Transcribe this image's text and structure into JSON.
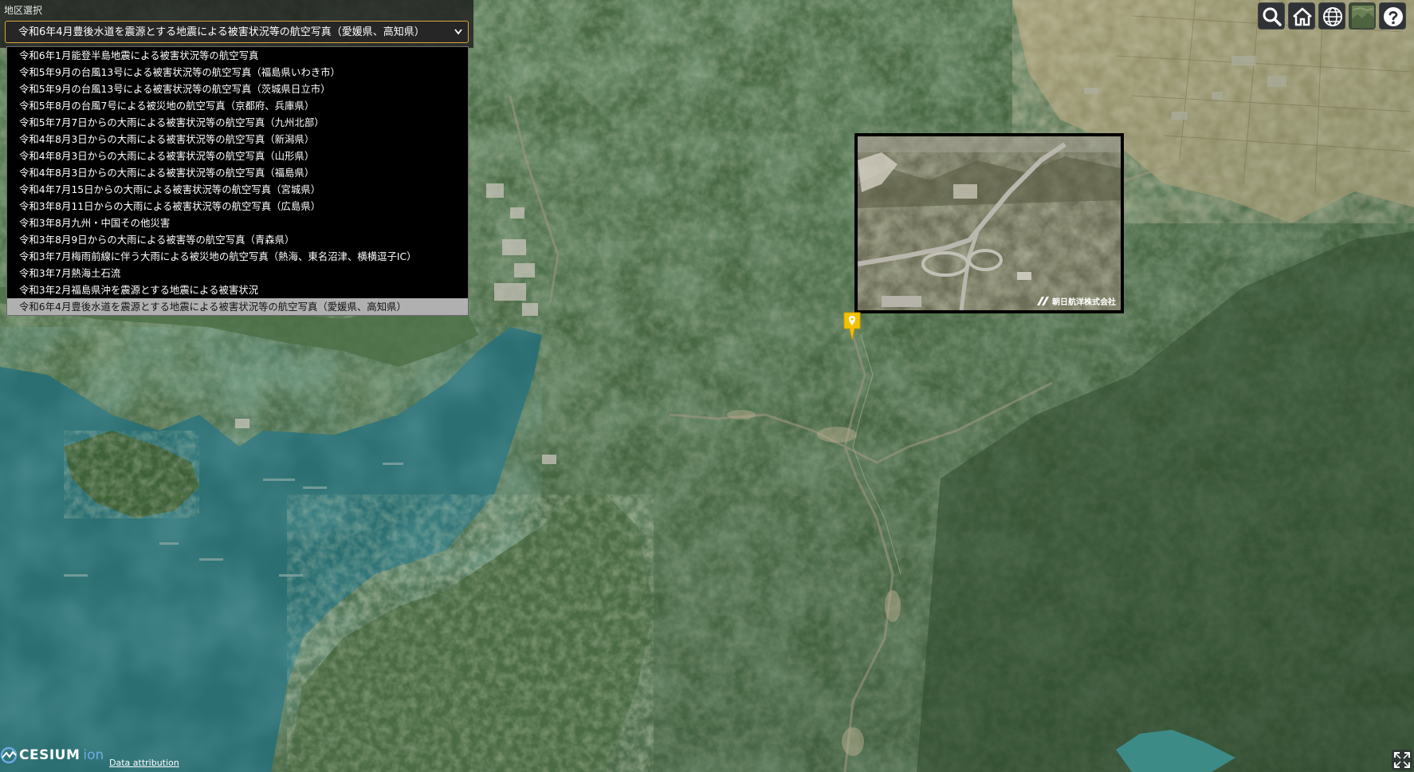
{
  "region_panel": {
    "label": "地区選択",
    "selected": "令和6年4月豊後水道を震源とする地震による被害状況等の航空写真（愛媛県、高知県）",
    "options": [
      "令和6年1月能登半島地震による被害状況等の航空写真",
      "令和5年9月の台風13号による被害状況等の航空写真（福島県いわき市）",
      "令和5年9月の台風13号による被害状況等の航空写真（茨城県日立市）",
      "令和5年8月の台風7号による被災地の航空写真（京都府、兵庫県）",
      "令和5年7月7日からの大雨による被害状況等の航空写真（九州北部）",
      "令和4年8月3日からの大雨による被害状況等の航空写真（新潟県）",
      "令和4年8月3日からの大雨による被害状況等の航空写真（山形県）",
      "令和4年8月3日からの大雨による被害状況等の航空写真（福島県）",
      "令和4年7月15日からの大雨による被害状況等の航空写真（宮城県）",
      "令和3年8月11日からの大雨による被害状況等の航空写真（広島県）",
      "令和3年8月九州・中国その他災害",
      "令和3年8月9日からの大雨による被害等の航空写真（青森県）",
      "令和3年7月梅雨前線に伴う大雨による被災地の航空写真（熱海、東名沼津、横横逗子IC）",
      "令和3年7月熱海土石流",
      "令和3年2月福島県沖を震源とする地震による被害状況",
      "令和6年4月豊後水道を震源とする地震による被害状況等の航空写真（愛媛県、高知県）"
    ],
    "selected_index": 15
  },
  "toolbar": {
    "buttons": [
      {
        "name": "search-button",
        "icon": "search-icon"
      },
      {
        "name": "home-button",
        "icon": "home-icon"
      },
      {
        "name": "scene-mode-button",
        "icon": "globe-icon"
      },
      {
        "name": "base-layer-button",
        "icon": "imagery-icon"
      },
      {
        "name": "help-button",
        "icon": "help-icon"
      }
    ]
  },
  "photo_popup": {
    "credit": "朝日航洋株式会社"
  },
  "credits": {
    "logo_text": "CESIUM",
    "logo_suffix": "ion",
    "attribution": "Data attribution"
  },
  "colors": {
    "select_border": "#d9a53a",
    "marker": "#f2c200",
    "cesium_ion": "#6dabe4"
  }
}
